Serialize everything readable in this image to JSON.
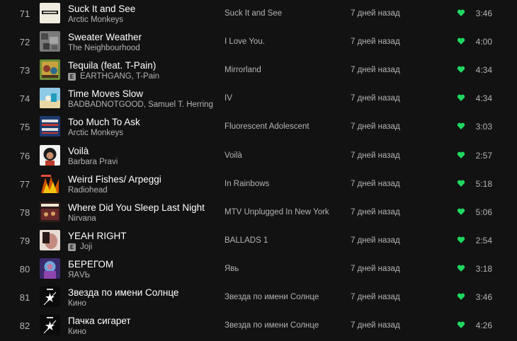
{
  "colors": {
    "background": "#121212",
    "accent_green": "#1ed760",
    "text_primary": "#ffffff",
    "text_secondary": "#b3b3b3"
  },
  "tracks": [
    {
      "num": "71",
      "title": "Suck It and See",
      "artist": "Arctic Monkeys",
      "explicit": false,
      "album": "Suck It and See",
      "added": "7 дней назад",
      "duration": "3:46",
      "cover_text": "SUCK IT AND SEE",
      "cover_icon": "album-cover"
    },
    {
      "num": "72",
      "title": "Sweater Weather",
      "artist": "The Neighbourhood",
      "explicit": false,
      "album": "I Love You.",
      "added": "7 дней назад",
      "duration": "4:00",
      "cover_icon": "album-cover"
    },
    {
      "num": "73",
      "title": "Tequila (feat. T-Pain)",
      "artist": "EARTHGANG, T-Pain",
      "explicit": true,
      "explicit_label": "E",
      "album": "Mirrorland",
      "added": "7 дней назад",
      "duration": "4:34",
      "cover_icon": "album-cover"
    },
    {
      "num": "74",
      "title": "Time Moves Slow",
      "artist": "BADBADNOTGOOD, Samuel T. Herring",
      "explicit": false,
      "album": "IV",
      "added": "7 дней назад",
      "duration": "4:34",
      "cover_icon": "album-cover"
    },
    {
      "num": "75",
      "title": "Too Much To Ask",
      "artist": "Arctic Monkeys",
      "explicit": false,
      "album": "Fluorescent Adolescent",
      "added": "7 дней назад",
      "duration": "3:03",
      "cover_icon": "album-cover"
    },
    {
      "num": "76",
      "title": "Voilà",
      "artist": "Barbara Pravi",
      "explicit": false,
      "album": "Voilà",
      "added": "7 дней назад",
      "duration": "2:57",
      "cover_icon": "album-cover"
    },
    {
      "num": "77",
      "title": "Weird Fishes/ Arpeggi",
      "artist": "Radiohead",
      "explicit": false,
      "album": "In Rainbows",
      "added": "7 дней назад",
      "duration": "5:18",
      "cover_icon": "album-cover"
    },
    {
      "num": "78",
      "title": "Where Did You Sleep Last Night",
      "artist": "Nirvana",
      "explicit": false,
      "album": "MTV Unplugged In New York",
      "added": "7 дней назад",
      "duration": "5:06",
      "cover_icon": "album-cover"
    },
    {
      "num": "79",
      "title": "YEAH RIGHT",
      "artist": "Joji",
      "explicit": true,
      "explicit_label": "E",
      "album": "BALLADS 1",
      "added": "7 дней назад",
      "duration": "2:54",
      "cover_icon": "album-cover"
    },
    {
      "num": "80",
      "title": "БЕРЕГОМ",
      "artist": "ЯАVЬ",
      "explicit": false,
      "album": "Явь",
      "added": "7 дней назад",
      "duration": "3:18",
      "cover_icon": "album-cover"
    },
    {
      "num": "81",
      "title": "Звезда по имени Солнце",
      "artist": "Кино",
      "explicit": false,
      "album": "Звезда по имени Солнце",
      "added": "7 дней назад",
      "duration": "3:46",
      "cover_icon": "album-cover"
    },
    {
      "num": "82",
      "title": "Пачка сигарет",
      "artist": "Кино",
      "explicit": false,
      "album": "Звезда по имени Солнце",
      "added": "7 дней назад",
      "duration": "4:26",
      "cover_icon": "album-cover"
    }
  ]
}
